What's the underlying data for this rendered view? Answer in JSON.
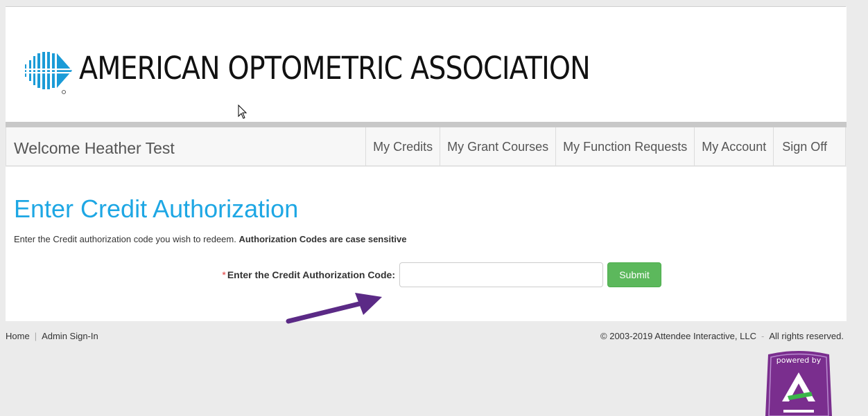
{
  "header": {
    "logo_text": "AMERICAN OPTOMETRIC ASSOCIATION",
    "logo_icon": "aoa-striped-arrow-logo"
  },
  "nav": {
    "welcome": "Welcome Heather Test",
    "items": [
      {
        "label": "My Credits"
      },
      {
        "label": "My Grant Courses"
      },
      {
        "label": "My Function Requests"
      },
      {
        "label": "My Account"
      },
      {
        "label": "Sign Off"
      }
    ]
  },
  "main": {
    "title": "Enter Credit Authorization",
    "instruction": "Enter the Credit authorization code you wish to redeem.",
    "instruction_bold": "Authorization Codes are case sensitive",
    "form": {
      "required_marker": "*",
      "label": "Enter the Credit Authorization Code:",
      "input_value": "",
      "submit_label": "Submit"
    }
  },
  "footer": {
    "links": [
      "Home",
      "Admin Sign-In"
    ],
    "separator": "|",
    "copyright": "© 2003-2019 Attendee Interactive, LLC",
    "copyright_sep": "-",
    "rights": "All rights reserved.",
    "badge_text": "powered by"
  },
  "colors": {
    "title_blue": "#1ea7e4",
    "submit_green": "#5cb85c",
    "logo_blue": "#1b9bd7",
    "annotation_purple": "#5b2a86",
    "badge_purple": "#7a2e8e"
  }
}
